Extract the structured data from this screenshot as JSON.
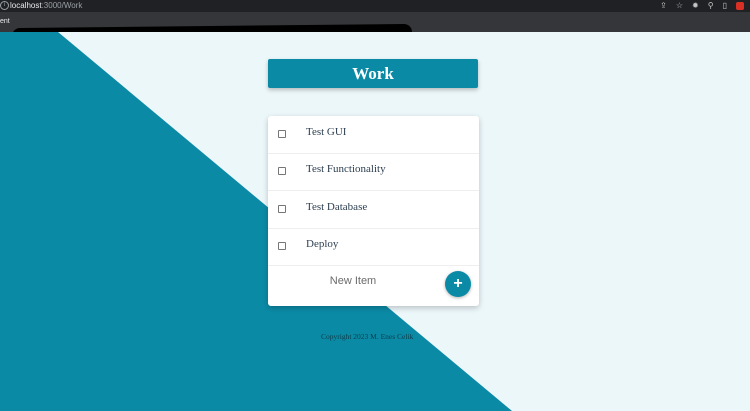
{
  "browser": {
    "url_host": "localhost",
    "url_path": ":3000/Work",
    "bookmark_label": "ent",
    "extension_icons": [
      "share-icon",
      "star-icon",
      "extension-puzzle-icon",
      "pin-icon",
      "tab-icon",
      "profile-icon"
    ]
  },
  "page": {
    "title": "Work",
    "items": [
      {
        "label": "Test GUI",
        "checked": false
      },
      {
        "label": "Test Functionality",
        "checked": false
      },
      {
        "label": "Test Database",
        "checked": false
      },
      {
        "label": "Deploy",
        "checked": false
      }
    ],
    "new_item_placeholder": "New Item",
    "add_button_label": "+",
    "footer": "Copyright 2023 M. Enes Celik"
  },
  "colors": {
    "accent": "#0b8aa6",
    "background": "#ecf7fa",
    "card": "#ffffff"
  }
}
